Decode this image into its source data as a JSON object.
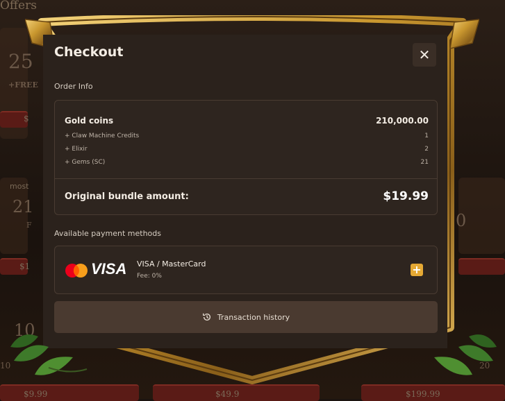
{
  "background": {
    "title": "Offers",
    "left_amount": "25",
    "left_free": "+FREE",
    "most_label": "most",
    "mid_amount": "21",
    "mid_f": "F",
    "right_amount": "0",
    "bottom_left_amount": "10",
    "bottom_left_small": "10",
    "bottom_right_small": "20",
    "price_1": "$9.99",
    "price_2": "$49.9",
    "price_3": "$199.99",
    "price_side_1": "$",
    "price_side_2": "$1"
  },
  "modal": {
    "title": "Checkout",
    "close_label": "✕",
    "order_info_label": "Order Info",
    "order": {
      "main_item": {
        "name": "Gold coins",
        "value": "210,000.00"
      },
      "extras": [
        {
          "name": "+ Claw Machine Credits",
          "value": "1"
        },
        {
          "name": "+ Elixir",
          "value": "2"
        },
        {
          "name": "+ Gems (SC)",
          "value": "21"
        }
      ],
      "total_label": "Original bundle amount:",
      "total_value": "$19.99"
    },
    "payment_label": "Available payment methods",
    "payment": {
      "logo_text": "VISA",
      "name": "VISA / MasterCard",
      "fee": "Fee: 0%",
      "add_label": "+"
    },
    "history_label": "Transaction history"
  },
  "colors": {
    "modal_bg": "#2b221c",
    "gold_frame": "#c9972f",
    "accent_plus": "#e5a934",
    "button_bg": "#4a3a30"
  },
  "icons": [
    "close-icon",
    "mastercard-icon",
    "visa-icon",
    "plus-icon",
    "history-icon",
    "leaf-decoration"
  ]
}
